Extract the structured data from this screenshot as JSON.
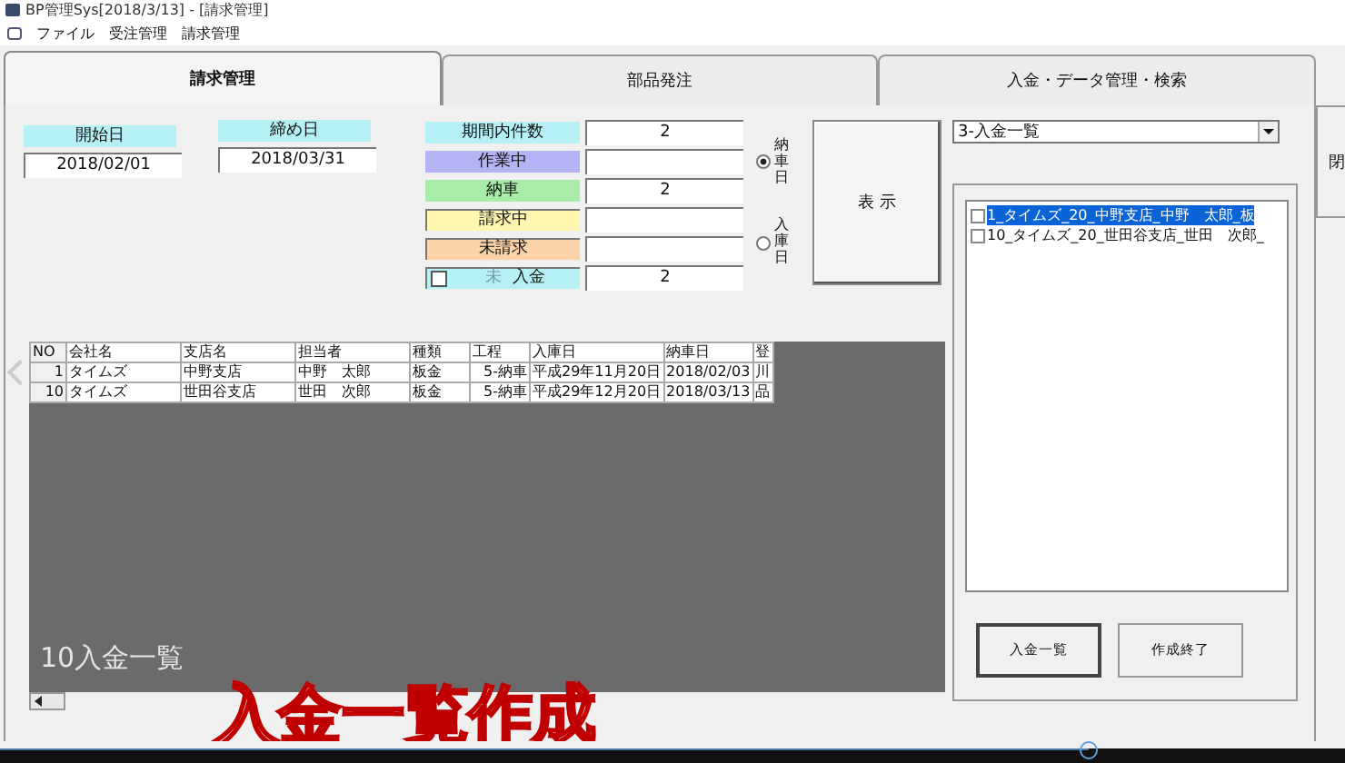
{
  "window": {
    "title": "BP管理Sys[2018/3/13] - [請求管理]"
  },
  "menu": [
    "ファイル",
    "受注管理",
    "請求管理"
  ],
  "tabs": [
    {
      "label": "請求管理",
      "selected": true
    },
    {
      "label": "部品発注",
      "selected": false
    },
    {
      "label": "入金・データ管理・検索",
      "selected": false
    }
  ],
  "side_button": "閉",
  "dates": [
    {
      "label": "開始日",
      "value": "2018/02/01"
    },
    {
      "label": "締め日",
      "value": "2018/03/31"
    }
  ],
  "counts": [
    {
      "label": "期間内件数",
      "value": "2",
      "color": "#b4f0f4",
      "kind": "plain"
    },
    {
      "label": "作業中",
      "color": "#b4b4f4",
      "kind": "plain"
    },
    {
      "label": "納車",
      "value": "2",
      "color": "#a8eca8",
      "kind": "plain"
    },
    {
      "label": "請求中",
      "color": "#fff6b0",
      "kind": "plain"
    },
    {
      "label": "未請求",
      "color": "#fcd2a8",
      "kind": "plain"
    },
    {
      "label": "入金",
      "prefix": "未",
      "value": "2",
      "color": "#b4f0f4",
      "kind": "checkbox",
      "checked": false
    }
  ],
  "date_basis": [
    {
      "label": "納車日",
      "selected": true
    },
    {
      "label": "入庫日",
      "selected": false
    }
  ],
  "show_button": "表 示",
  "report_select": {
    "value": "3-入金一覧"
  },
  "report_list": [
    {
      "text": "1_タイムズ_20_中野支店_中野　太郎_板",
      "checked": false,
      "selected": true
    },
    {
      "text": "10_タイムズ_20_世田谷支店_世田　次郎_",
      "checked": false,
      "selected": false
    }
  ],
  "report_buttons": [
    "入金一覧",
    "作成終了"
  ],
  "table": {
    "columns": [
      "NO",
      "会社名",
      "支店名",
      "担当者",
      "種類",
      "工程",
      "入庫日",
      "納車日",
      "登"
    ],
    "rows": [
      [
        "1",
        "タイムズ",
        "中野支店",
        "中野　太郎",
        "板金",
        "5-納車",
        "平成29年11月20日",
        "2018/02/03",
        "川"
      ],
      [
        "10",
        "タイムズ",
        "世田谷支店",
        "世田　次郎",
        "板金",
        "5-納車",
        "平成29年12月20日",
        "2018/03/13",
        "品"
      ]
    ]
  },
  "video_caption": "10入金一覧",
  "video_title": "入金一覧作成",
  "video_progress": {
    "level": 0.81
  }
}
